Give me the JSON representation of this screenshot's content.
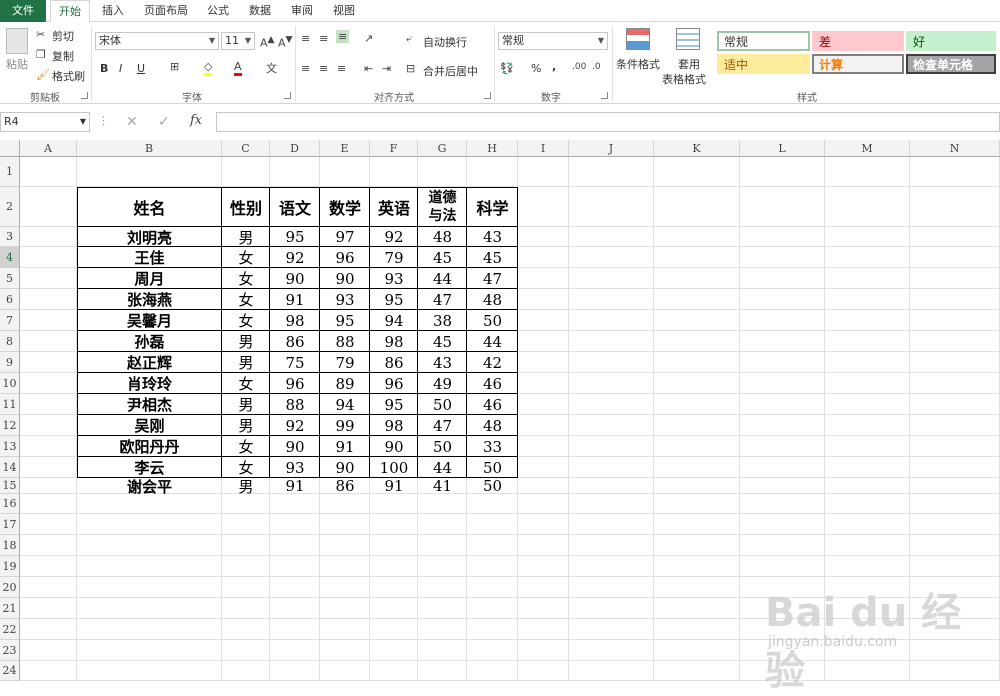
{
  "tabs": [
    "文件",
    "开始",
    "插入",
    "页面布局",
    "公式",
    "数据",
    "审阅",
    "视图"
  ],
  "clipboard": {
    "paste": "粘贴",
    "cut": "剪切",
    "copy": "复制",
    "format_painter": "格式刷",
    "group": "剪贴板"
  },
  "font": {
    "name": "宋体",
    "size": "11",
    "bold": "B",
    "italic": "I",
    "underline": "U",
    "group": "字体"
  },
  "alignment": {
    "wrap": "自动换行",
    "merge": "合并后居中",
    "group": "对齐方式"
  },
  "number": {
    "format": "常规",
    "percent": "%",
    "comma": ",",
    "group": "数字"
  },
  "styles": {
    "conditional": "条件格式",
    "table_format_1": "套用",
    "table_format_2": "表格格式",
    "group": "样式",
    "cells": [
      {
        "label": "常规",
        "bg": "#ffffff",
        "fg": "#333333",
        "border": "#9bc6a8"
      },
      {
        "label": "差",
        "bg": "#ffc7ce",
        "fg": "#9c0006",
        "border": "#ffc7ce"
      },
      {
        "label": "好",
        "bg": "#c6efce",
        "fg": "#006100",
        "border": "#c6efce"
      },
      {
        "label": "适中",
        "bg": "#ffeb9c",
        "fg": "#9c5700",
        "border": "#ffeb9c"
      },
      {
        "label": "计算",
        "bg": "#f2f2f2",
        "fg": "#fa7d00",
        "border": "#7f7f7f"
      },
      {
        "label": "检查单元格",
        "bg": "#a5a5a5",
        "fg": "#ffffff",
        "border": "#3f3f3f"
      }
    ]
  },
  "formula_bar": {
    "name_box": "R4",
    "fx": "fx",
    "value": ""
  },
  "columns": [
    "A",
    "B",
    "C",
    "D",
    "E",
    "F",
    "G",
    "H",
    "I",
    "J",
    "K",
    "L",
    "M",
    "N"
  ],
  "rows": [
    "1",
    "2",
    "3",
    "4",
    "5",
    "6",
    "7",
    "8",
    "9",
    "10",
    "11",
    "12",
    "13",
    "14",
    "15",
    "16",
    "17",
    "18",
    "19",
    "20",
    "21",
    "22",
    "23",
    "24"
  ],
  "table": {
    "headers": [
      "姓名",
      "性别",
      "语文",
      "数学",
      "英语",
      "道德\n与法",
      "科学"
    ],
    "rows": [
      [
        "刘明亮",
        "男",
        "95",
        "97",
        "92",
        "48",
        "43"
      ],
      [
        "王佳",
        "女",
        "92",
        "96",
        "79",
        "45",
        "45"
      ],
      [
        "周月",
        "女",
        "90",
        "90",
        "93",
        "44",
        "47"
      ],
      [
        "张海燕",
        "女",
        "91",
        "93",
        "95",
        "47",
        "48"
      ],
      [
        "吴馨月",
        "女",
        "98",
        "95",
        "94",
        "38",
        "50"
      ],
      [
        "孙磊",
        "男",
        "86",
        "88",
        "98",
        "45",
        "44"
      ],
      [
        "赵正辉",
        "男",
        "75",
        "79",
        "86",
        "43",
        "42"
      ],
      [
        "肖玲玲",
        "女",
        "96",
        "89",
        "96",
        "49",
        "46"
      ],
      [
        "尹相杰",
        "男",
        "88",
        "94",
        "95",
        "50",
        "46"
      ],
      [
        "吴刚",
        "男",
        "92",
        "99",
        "98",
        "47",
        "48"
      ],
      [
        "欧阳丹丹",
        "女",
        "90",
        "91",
        "90",
        "50",
        "33"
      ],
      [
        "李云",
        "女",
        "93",
        "90",
        "100",
        "44",
        "50"
      ],
      [
        "谢会平",
        "男",
        "91",
        "86",
        "91",
        "41",
        "50"
      ]
    ]
  },
  "watermark": {
    "main": "Bai du 经验",
    "sub": "jingyan.baidu.com"
  }
}
